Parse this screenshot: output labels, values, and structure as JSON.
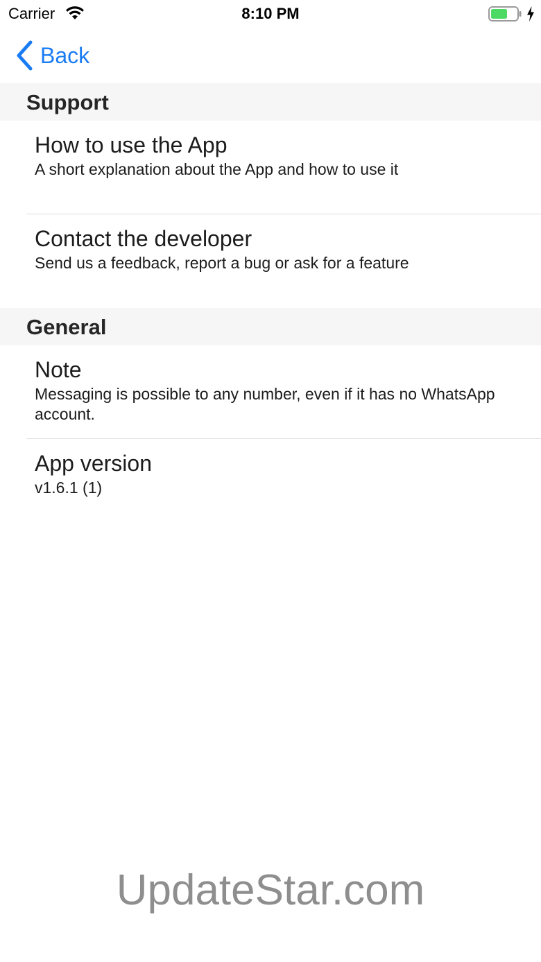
{
  "status_bar": {
    "carrier": "Carrier",
    "time": "8:10 PM",
    "wifi_icon": "wifi-icon",
    "battery_icon": "battery-icon",
    "charging_icon": "charging-bolt-icon",
    "battery_color": "#4cd964"
  },
  "nav": {
    "back_label": "Back",
    "back_icon": "chevron-left-icon",
    "accent_color": "#1a7cf3"
  },
  "sections": [
    {
      "header": "Support",
      "items": [
        {
          "title": "How to use the App",
          "subtitle": "A short explanation about the App and how to use it"
        },
        {
          "title": "Contact the developer",
          "subtitle": "Send us a feedback, report a bug or ask for a feature"
        }
      ]
    },
    {
      "header": "General",
      "items": [
        {
          "title": "Note",
          "subtitle": "Messaging is possible to any number, even if it has no WhatsApp account."
        },
        {
          "title": "App version",
          "subtitle": "v1.6.1 (1)"
        }
      ]
    }
  ],
  "watermark": "UpdateStar.com"
}
